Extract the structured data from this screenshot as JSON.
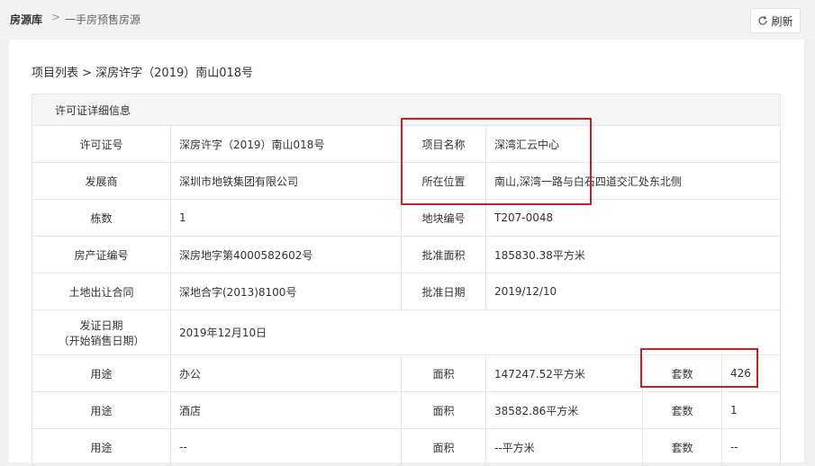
{
  "header": {
    "breadcrumb_root": "房源库",
    "breadcrumb_sep": ">",
    "breadcrumb_current": "一手房预售房源",
    "refresh_label": "刷新",
    "refresh_icon": "refresh-icon"
  },
  "sub_breadcrumb": "项目列表 > 深房许字（2019）南山018号",
  "section_title": "许可证详细信息",
  "rows": {
    "license_no": {
      "label": "许可证号",
      "value": "深房许字（2019）南山018号"
    },
    "project_name": {
      "label": "项目名称",
      "value": "深湾汇云中心"
    },
    "developer": {
      "label": "发展商",
      "value": "深圳市地铁集团有限公司"
    },
    "location": {
      "label": "所在位置",
      "value": "南山,深湾一路与白石四道交汇处东北侧"
    },
    "buildings": {
      "label": "栋数",
      "value": "1"
    },
    "plot_no": {
      "label": "地块编号",
      "value": "T207-0048"
    },
    "property_cert": {
      "label": "房产证编号",
      "value": "深房地字第4000582602号"
    },
    "approved_area": {
      "label": "批准面积",
      "value": "185830.38平方米"
    },
    "land_contract": {
      "label": "土地出让合同",
      "value": "深地合字(2013)8100号"
    },
    "approved_date": {
      "label": "批准日期",
      "value": "2019/12/10"
    },
    "issue_date": {
      "label_line1": "发证日期",
      "label_line2": "（开始销售日期）",
      "value": "2019年12月10日"
    }
  },
  "usage_rows": [
    {
      "use_label": "用途",
      "use": "办公",
      "area_label": "面积",
      "area": "147247.52平方米",
      "units_label": "套数",
      "units": "426"
    },
    {
      "use_label": "用途",
      "use": "酒店",
      "area_label": "面积",
      "area": "38582.86平方米",
      "units_label": "套数",
      "units": "1"
    },
    {
      "use_label": "用途",
      "use": "--",
      "area_label": "面积",
      "area": "--平方米",
      "units_label": "套数",
      "units": "--"
    }
  ],
  "colors": {
    "highlight": "#cc2020",
    "border": "#e6e6e6",
    "section_bg": "#f5f5f5"
  }
}
